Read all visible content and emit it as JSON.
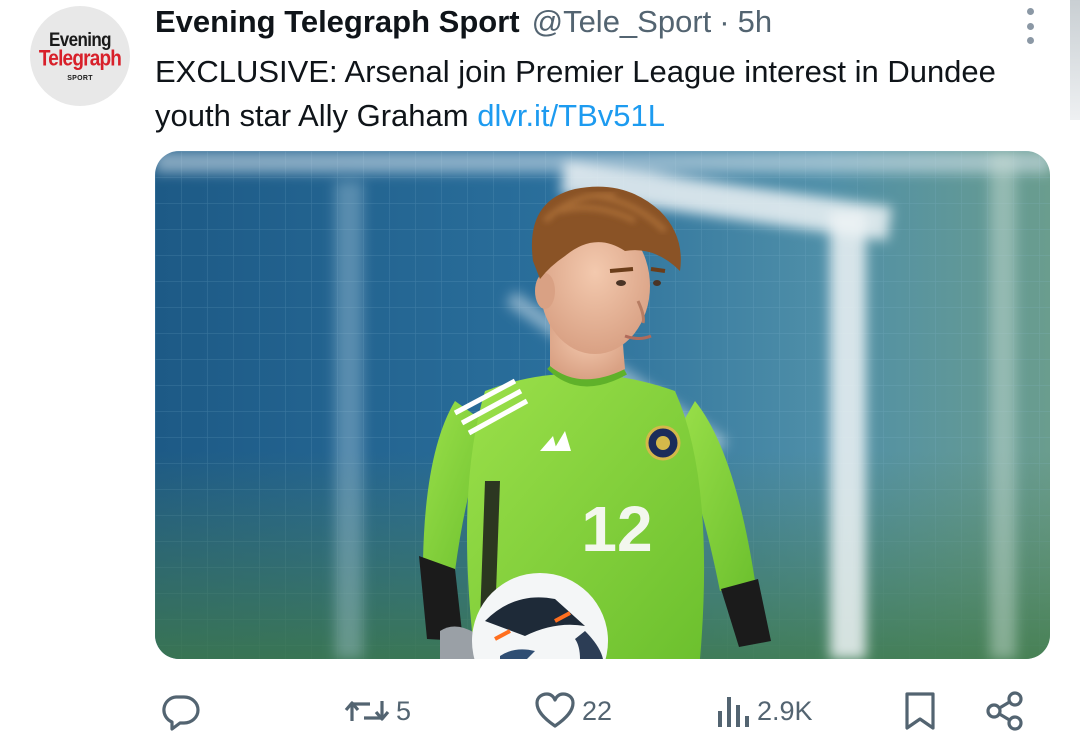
{
  "account": {
    "display_name": "Evening Telegraph Sport",
    "handle": "@Tele_Sport",
    "separator": "·",
    "time": "5h",
    "avatar_logo": {
      "line1": "Evening",
      "line2": "Telegraph",
      "line3": "SPORT"
    }
  },
  "tweet": {
    "text": "EXCLUSIVE: Arsenal join Premier League interest in Dundee youth star Ally Graham",
    "link": "dlvr.it/TBv51L"
  },
  "media": {
    "shirt_number": "12"
  },
  "actions": {
    "reply": {
      "icon": "reply-icon",
      "count": ""
    },
    "repost": {
      "icon": "repost-icon",
      "count": "5"
    },
    "like": {
      "icon": "heart-icon",
      "count": "22"
    },
    "views": {
      "icon": "views-icon",
      "count": "2.9K"
    },
    "bookmark": {
      "icon": "bookmark-icon"
    },
    "share": {
      "icon": "share-icon"
    }
  },
  "colors": {
    "text": "#0f1419",
    "secondary": "#536471",
    "link": "#1d9bf0",
    "logo_red": "#d8202a"
  }
}
